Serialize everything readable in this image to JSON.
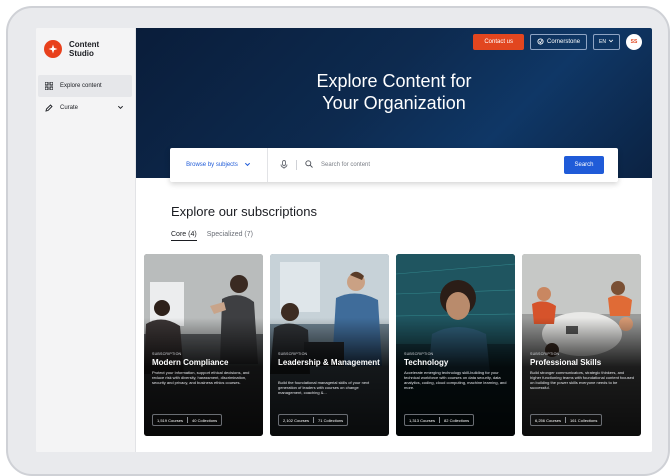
{
  "brand": {
    "name_line1": "Content",
    "name_line2": "Studio",
    "logo_icon": "spark-icon",
    "accent": "#e8401c"
  },
  "sidebar": {
    "items": [
      {
        "label": "Explore content",
        "icon": "grid-icon",
        "active": true
      },
      {
        "label": "Curate",
        "icon": "pen-icon",
        "expandable": true
      }
    ]
  },
  "header": {
    "contact_label": "Contact us",
    "cornerstone_label": "Cornerstone",
    "language": "EN",
    "avatar_initials": "SS"
  },
  "hero": {
    "title_line1": "Explore Content for",
    "title_line2": "Your Organization"
  },
  "search": {
    "browse_label": "Browse by subjects",
    "placeholder": "Search for content",
    "button_label": "Search"
  },
  "subscriptions": {
    "title": "Explore our subscriptions",
    "tabs": [
      {
        "label": "Core (4)",
        "active": true
      },
      {
        "label": "Specialized (7)",
        "active": false
      }
    ],
    "cards": [
      {
        "kicker": "SUBSCRIPTION",
        "title": "Modern Compliance",
        "description": "Protect your information, support ethical decisions, and reduce risk with diversity, harassment, discrimination, security and privacy, and business ethics courses.",
        "courses": "1,519 Courses",
        "collections": "40 Collections"
      },
      {
        "kicker": "SUBSCRIPTION",
        "title": "Leadership & Management",
        "description": "Build the foundational managerial skills of your next generation of leaders with courses on change management, coaching &...",
        "courses": "2,102 Courses",
        "collections": "71 Collections"
      },
      {
        "kicker": "SUBSCRIPTION",
        "title": "Technology",
        "description": "Accelerate emerging technology skill-building for your technical workforce with courses on data security, data analytics, coding, cloud computing, machine learning, and more.",
        "courses": "1,313 Courses",
        "collections": "82 Collections"
      },
      {
        "kicker": "SUBSCRIPTION",
        "title": "Professional Skills",
        "description": "Build stronger communicators, strategic thinkers, and higher functioning teams with foundational content focused on building the power skills everyone needs to be successful.",
        "courses": "6,256 Courses",
        "collections": "161 Collections"
      }
    ]
  },
  "colors": {
    "primary_blue": "#1f5bd8",
    "contact_orange": "#e2461f",
    "hero_navy": "#0d2a4f"
  }
}
